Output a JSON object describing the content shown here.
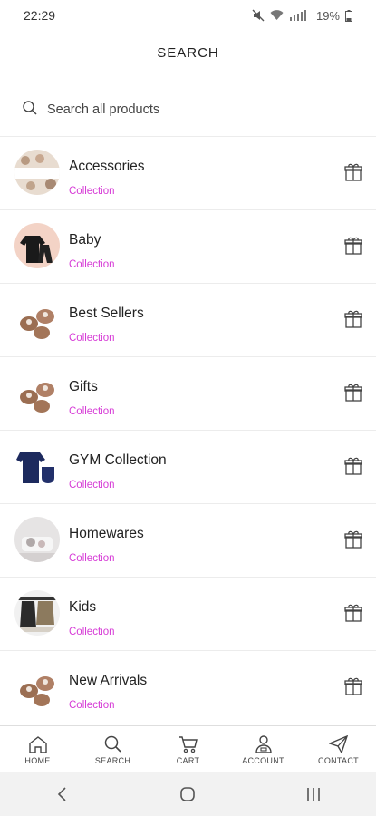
{
  "status_bar": {
    "time": "22:29",
    "battery": "19%"
  },
  "header": {
    "title": "SEARCH"
  },
  "search": {
    "placeholder": "Search all products"
  },
  "collections": [
    {
      "title": "Accessories",
      "subtitle": "Collection",
      "icon": "gift-icon"
    },
    {
      "title": "Baby",
      "subtitle": "Collection",
      "icon": "gift-icon"
    },
    {
      "title": "Best Sellers",
      "subtitle": "Collection",
      "icon": "gift-icon"
    },
    {
      "title": "Gifts",
      "subtitle": "Collection",
      "icon": "gift-icon"
    },
    {
      "title": "GYM Collection",
      "subtitle": "Collection",
      "icon": "gift-icon"
    },
    {
      "title": "Homewares",
      "subtitle": "Collection",
      "icon": "gift-icon"
    },
    {
      "title": "Kids",
      "subtitle": "Collection",
      "icon": "gift-icon"
    },
    {
      "title": "New Arrivals",
      "subtitle": "Collection",
      "icon": "gift-icon"
    }
  ],
  "bottom_nav": {
    "home": "HOME",
    "search": "SEARCH",
    "cart": "CART",
    "account": "ACCOUNT",
    "contact": "CONTACT"
  },
  "colors": {
    "accent": "#d63ad6"
  }
}
